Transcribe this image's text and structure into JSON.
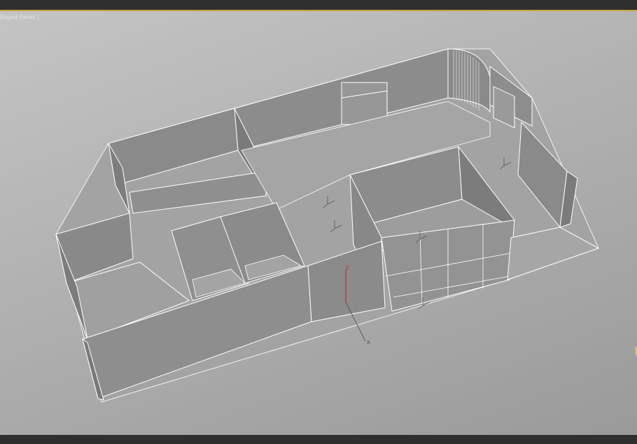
{
  "viewport": {
    "label": "Edged Faces ]",
    "render_mode": "shaded + wireframe edges",
    "background_color": "#b5b5b5",
    "wall_color": "#8e8e8e",
    "floor_color": "#a2a2a2",
    "edge_color": "#ffffff"
  },
  "gizmo": {
    "z_label": "Z",
    "x_label": "X",
    "z_color": "#c0392b"
  },
  "frame": {
    "accent_color": "#c9a63a",
    "bar_color": "#2f2f2f"
  }
}
